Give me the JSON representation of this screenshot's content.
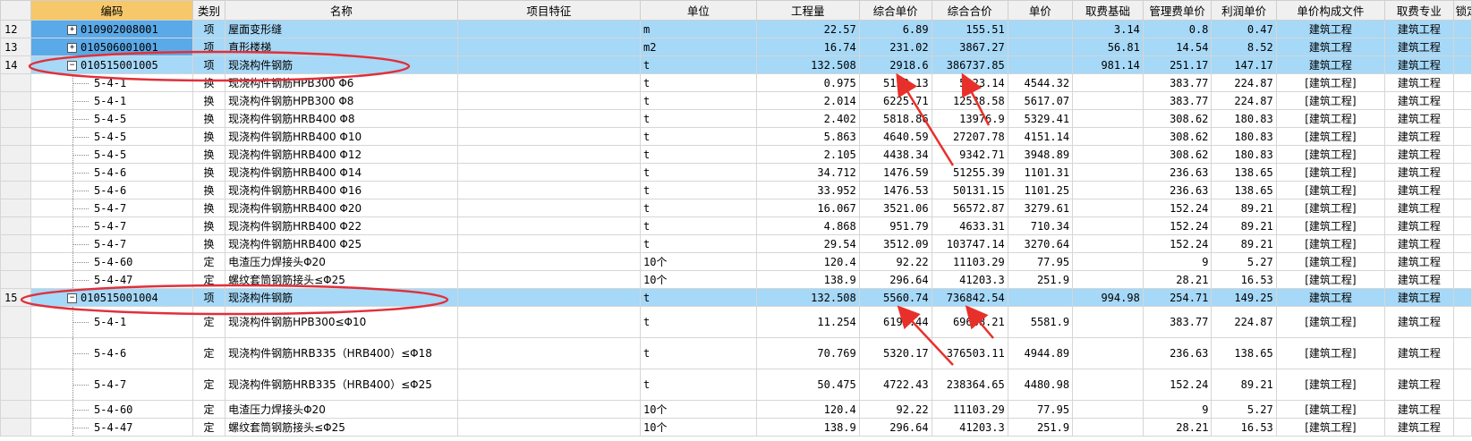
{
  "headers": [
    "编码",
    "类别",
    "名称",
    "项目特征",
    "单位",
    "工程量",
    "综合单价",
    "综合合价",
    "单价",
    "取费基础",
    "管理费单价",
    "利润单价",
    "单价构成文件",
    "取费专业",
    "锁定"
  ],
  "rows": [
    {
      "rn": "12",
      "code": "010902008001",
      "type": "项",
      "name": "屋面变形缝",
      "feature": "",
      "unit": "m",
      "qty": "22.57",
      "uprice": "6.89",
      "total": "155.51",
      "price": "",
      "base": "3.14",
      "mgmt": "0.8",
      "profit": "0.47",
      "file": "建筑工程",
      "prof": "建筑工程",
      "style": "hl",
      "expander": "+",
      "sel": true
    },
    {
      "rn": "13",
      "code": "010506001001",
      "type": "项",
      "name": "直形楼梯",
      "feature": "",
      "unit": "m2",
      "qty": "16.74",
      "uprice": "231.02",
      "total": "3867.27",
      "price": "",
      "base": "56.81",
      "mgmt": "14.54",
      "profit": "8.52",
      "file": "建筑工程",
      "prof": "建筑工程",
      "style": "hl",
      "expander": "+",
      "sel": true
    },
    {
      "rn": "14",
      "code": "010515001005",
      "type": "项",
      "name": "现浇构件钢筋",
      "feature": "",
      "unit": "t",
      "qty": "132.508",
      "uprice": "2918.6",
      "total": "386737.85",
      "price": "",
      "base": "981.14",
      "mgmt": "251.17",
      "profit": "147.17",
      "file": "建筑工程",
      "prof": "建筑工程",
      "style": "hl",
      "expander": "−"
    },
    {
      "rn": "",
      "code": "5-4-1",
      "type": "换",
      "name": "现浇构件钢筋HPB300 Φ6",
      "feature": "",
      "unit": "t",
      "qty": "0.975",
      "uprice": "5152.13",
      "total": "5023.14",
      "price": "4544.32",
      "base": "",
      "mgmt": "383.77",
      "profit": "224.87",
      "file": "[建筑工程]",
      "prof": "建筑工程",
      "style": "sub"
    },
    {
      "rn": "",
      "code": "5-4-1",
      "type": "换",
      "name": "现浇构件钢筋HPB300 Φ8",
      "feature": "",
      "unit": "t",
      "qty": "2.014",
      "uprice": "6225.71",
      "total": "12538.58",
      "price": "5617.07",
      "base": "",
      "mgmt": "383.77",
      "profit": "224.87",
      "file": "[建筑工程]",
      "prof": "建筑工程",
      "style": "sub"
    },
    {
      "rn": "",
      "code": "5-4-5",
      "type": "换",
      "name": "现浇构件钢筋HRB400 Φ8",
      "feature": "",
      "unit": "t",
      "qty": "2.402",
      "uprice": "5818.86",
      "total": "13976.9",
      "price": "5329.41",
      "base": "",
      "mgmt": "308.62",
      "profit": "180.83",
      "file": "[建筑工程]",
      "prof": "建筑工程",
      "style": "sub"
    },
    {
      "rn": "",
      "code": "5-4-5",
      "type": "换",
      "name": "现浇构件钢筋HRB400 Φ10",
      "feature": "",
      "unit": "t",
      "qty": "5.863",
      "uprice": "4640.59",
      "total": "27207.78",
      "price": "4151.14",
      "base": "",
      "mgmt": "308.62",
      "profit": "180.83",
      "file": "[建筑工程]",
      "prof": "建筑工程",
      "style": "sub"
    },
    {
      "rn": "",
      "code": "5-4-5",
      "type": "换",
      "name": "现浇构件钢筋HRB400 Φ12",
      "feature": "",
      "unit": "t",
      "qty": "2.105",
      "uprice": "4438.34",
      "total": "9342.71",
      "price": "3948.89",
      "base": "",
      "mgmt": "308.62",
      "profit": "180.83",
      "file": "[建筑工程]",
      "prof": "建筑工程",
      "style": "sub"
    },
    {
      "rn": "",
      "code": "5-4-6",
      "type": "换",
      "name": "现浇构件钢筋HRB400 Φ14",
      "feature": "",
      "unit": "t",
      "qty": "34.712",
      "uprice": "1476.59",
      "total": "51255.39",
      "price": "1101.31",
      "base": "",
      "mgmt": "236.63",
      "profit": "138.65",
      "file": "[建筑工程]",
      "prof": "建筑工程",
      "style": "sub"
    },
    {
      "rn": "",
      "code": "5-4-6",
      "type": "换",
      "name": "现浇构件钢筋HRB400 Φ16",
      "feature": "",
      "unit": "t",
      "qty": "33.952",
      "uprice": "1476.53",
      "total": "50131.15",
      "price": "1101.25",
      "base": "",
      "mgmt": "236.63",
      "profit": "138.65",
      "file": "[建筑工程]",
      "prof": "建筑工程",
      "style": "sub"
    },
    {
      "rn": "",
      "code": "5-4-7",
      "type": "换",
      "name": "现浇构件钢筋HRB400 Φ20",
      "feature": "",
      "unit": "t",
      "qty": "16.067",
      "uprice": "3521.06",
      "total": "56572.87",
      "price": "3279.61",
      "base": "",
      "mgmt": "152.24",
      "profit": "89.21",
      "file": "[建筑工程]",
      "prof": "建筑工程",
      "style": "sub"
    },
    {
      "rn": "",
      "code": "5-4-7",
      "type": "换",
      "name": "现浇构件钢筋HRB400 Φ22",
      "feature": "",
      "unit": "t",
      "qty": "4.868",
      "uprice": "951.79",
      "total": "4633.31",
      "price": "710.34",
      "base": "",
      "mgmt": "152.24",
      "profit": "89.21",
      "file": "[建筑工程]",
      "prof": "建筑工程",
      "style": "sub"
    },
    {
      "rn": "",
      "code": "5-4-7",
      "type": "换",
      "name": "现浇构件钢筋HRB400 Φ25",
      "feature": "",
      "unit": "t",
      "qty": "29.54",
      "uprice": "3512.09",
      "total": "103747.14",
      "price": "3270.64",
      "base": "",
      "mgmt": "152.24",
      "profit": "89.21",
      "file": "[建筑工程]",
      "prof": "建筑工程",
      "style": "sub"
    },
    {
      "rn": "",
      "code": "5-4-60",
      "type": "定",
      "name": "电渣压力焊接头Φ20",
      "feature": "",
      "unit": "10个",
      "qty": "120.4",
      "uprice": "92.22",
      "total": "11103.29",
      "price": "77.95",
      "base": "",
      "mgmt": "9",
      "profit": "5.27",
      "file": "[建筑工程]",
      "prof": "建筑工程",
      "style": "sub"
    },
    {
      "rn": "",
      "code": "5-4-47",
      "type": "定",
      "name": "螺纹套筒钢筋接头≤Φ25",
      "feature": "",
      "unit": "10个",
      "qty": "138.9",
      "uprice": "296.64",
      "total": "41203.3",
      "price": "251.9",
      "base": "",
      "mgmt": "28.21",
      "profit": "16.53",
      "file": "[建筑工程]",
      "prof": "建筑工程",
      "style": "sub"
    },
    {
      "rn": "15",
      "code": "010515001004",
      "type": "项",
      "name": "现浇构件钢筋",
      "feature": "",
      "unit": "t",
      "qty": "132.508",
      "uprice": "5560.74",
      "total": "736842.54",
      "price": "",
      "base": "994.98",
      "mgmt": "254.71",
      "profit": "149.25",
      "file": "建筑工程",
      "prof": "建筑工程",
      "style": "hl",
      "expander": "−"
    },
    {
      "rn": "",
      "code": "5-4-1",
      "type": "定",
      "name": "现浇构件钢筋HPB300≤Φ10",
      "feature": "",
      "unit": "t",
      "qty": "11.254",
      "uprice": "6190.44",
      "total": "69668.21",
      "price": "5581.9",
      "base": "",
      "mgmt": "383.77",
      "profit": "224.87",
      "file": "[建筑工程]",
      "prof": "建筑工程",
      "style": "sub"
    },
    {
      "rn": "",
      "code": "5-4-6",
      "type": "定",
      "name": "现浇构件钢筋HRB335（HRB400）≤Φ18",
      "feature": "",
      "unit": "t",
      "qty": "70.769",
      "uprice": "5320.17",
      "total": "376503.11",
      "price": "4944.89",
      "base": "",
      "mgmt": "236.63",
      "profit": "138.65",
      "file": "[建筑工程]",
      "prof": "建筑工程",
      "style": "sub tall"
    },
    {
      "rn": "",
      "code": "5-4-7",
      "type": "定",
      "name": "现浇构件钢筋HRB335（HRB400）≤Φ25",
      "feature": "",
      "unit": "t",
      "qty": "50.475",
      "uprice": "4722.43",
      "total": "238364.65",
      "price": "4480.98",
      "base": "",
      "mgmt": "152.24",
      "profit": "89.21",
      "file": "[建筑工程]",
      "prof": "建筑工程",
      "style": "sub tall"
    },
    {
      "rn": "",
      "code": "5-4-60",
      "type": "定",
      "name": "电渣压力焊接头Φ20",
      "feature": "",
      "unit": "10个",
      "qty": "120.4",
      "uprice": "92.22",
      "total": "11103.29",
      "price": "77.95",
      "base": "",
      "mgmt": "9",
      "profit": "5.27",
      "file": "[建筑工程]",
      "prof": "建筑工程",
      "style": "sub"
    },
    {
      "rn": "",
      "code": "5-4-47",
      "type": "定",
      "name": "螺纹套筒钢筋接头≤Φ25",
      "feature": "",
      "unit": "10个",
      "qty": "138.9",
      "uprice": "296.64",
      "total": "41203.3",
      "price": "251.9",
      "base": "",
      "mgmt": "28.21",
      "profit": "16.53",
      "file": "[建筑工程]",
      "prof": "建筑工程",
      "style": "sub"
    }
  ],
  "annotation_colors": {
    "ellipse": "#e0303a",
    "arrow": "#e8302a"
  }
}
